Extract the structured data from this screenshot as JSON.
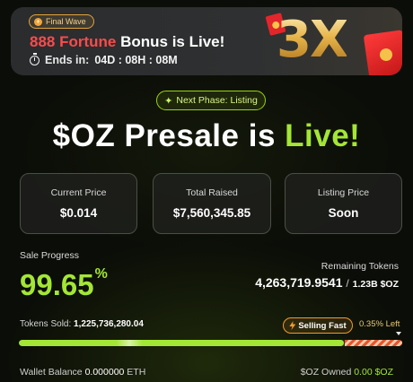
{
  "banner": {
    "wave_label": "Final Wave",
    "title_highlight": "888 Fortune",
    "title_rest": "Bonus is Live!",
    "timer_label": "Ends in:",
    "timer_value": "04D : 08H : 08M",
    "multiplier": "3X"
  },
  "phase_chip": {
    "label": "Next Phase: Listing"
  },
  "headline": {
    "prefix": "$OZ Presale is ",
    "highlight": "Live!"
  },
  "stats": [
    {
      "title": "Current Price",
      "value": "$0.014"
    },
    {
      "title": "Total Raised",
      "value": "$7,560,345.85"
    },
    {
      "title": "Listing Price",
      "value": "Soon"
    }
  ],
  "progress": {
    "label": "Sale Progress",
    "percent_value": "99.65",
    "percent_sign": "%",
    "fraction": 0.9965,
    "remaining_label": "Remaining Tokens",
    "remaining_value": "4,263,719.9541",
    "remaining_slash": "/",
    "remaining_total": "1.23B $OZ",
    "sold_label": "Tokens Sold:",
    "sold_value": "1,225,736,280.04",
    "fast_label": "Selling Fast",
    "left_label": "0.35% Left"
  },
  "wallet": {
    "balance_label": "Wallet Balance",
    "balance_value": "0.000000",
    "balance_unit": "ETH",
    "owned_label": "$OZ Owned",
    "owned_value": "0.00 $OZ"
  },
  "colors": {
    "accent_green": "#a3e635",
    "banner_red": "#ff4a4a",
    "gold": "#e7b54a",
    "warning_orange": "#f29a2e"
  }
}
